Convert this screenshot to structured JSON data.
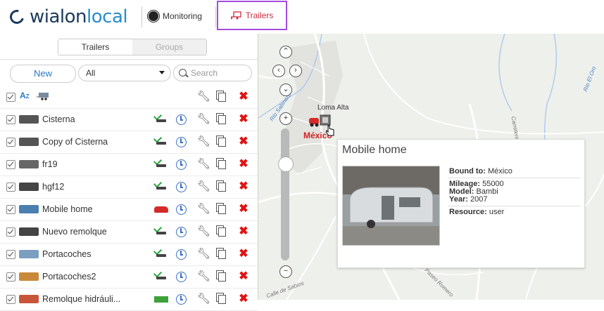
{
  "header": {
    "logo_main": "wialon",
    "logo_sub": "local",
    "nav": [
      {
        "label": "Monitoring",
        "icon": "globe-icon"
      },
      {
        "label": "Trailers",
        "icon": "trailer-icon",
        "active": true
      }
    ],
    "active_color": "#a54be0"
  },
  "panel": {
    "tabs": [
      {
        "label": "Trailers",
        "active": true
      },
      {
        "label": "Groups",
        "active": false
      }
    ],
    "new_label": "New",
    "filter_value": "All",
    "search_placeholder": "Search",
    "header_row": {
      "sort_icon": "sort-az-icon"
    },
    "rows": [
      {
        "name": "Cisterna",
        "status": "ok"
      },
      {
        "name": "Copy of Cisterna",
        "status": "ok"
      },
      {
        "name": "fr19",
        "status": "ok"
      },
      {
        "name": "hgf12",
        "status": "ok"
      },
      {
        "name": "Mobile home",
        "status": "car"
      },
      {
        "name": "Nuevo remolque",
        "status": "ok"
      },
      {
        "name": "Portacoches",
        "status": "ok"
      },
      {
        "name": "Portacoches2",
        "status": "ok"
      },
      {
        "name": "Remolque hidráuli...",
        "status": "truck"
      }
    ]
  },
  "map": {
    "place_labels": [
      "Loma Alta",
      "México"
    ],
    "street_labels": [
      "Río El Oro",
      "Río Sabinero",
      "Carretera",
      "Calle de Sabios",
      "Paseo Romero"
    ],
    "popup": {
      "title": "Mobile home",
      "bound_to_label": "Bound to:",
      "bound_to_value": "México",
      "mileage_label": "Mileage:",
      "mileage_value": "55000",
      "model_label": "Model:",
      "model_value": "Bambi",
      "year_label": "Year:",
      "year_value": "2007",
      "resource_label": "Resource:",
      "resource_value": "user"
    }
  }
}
